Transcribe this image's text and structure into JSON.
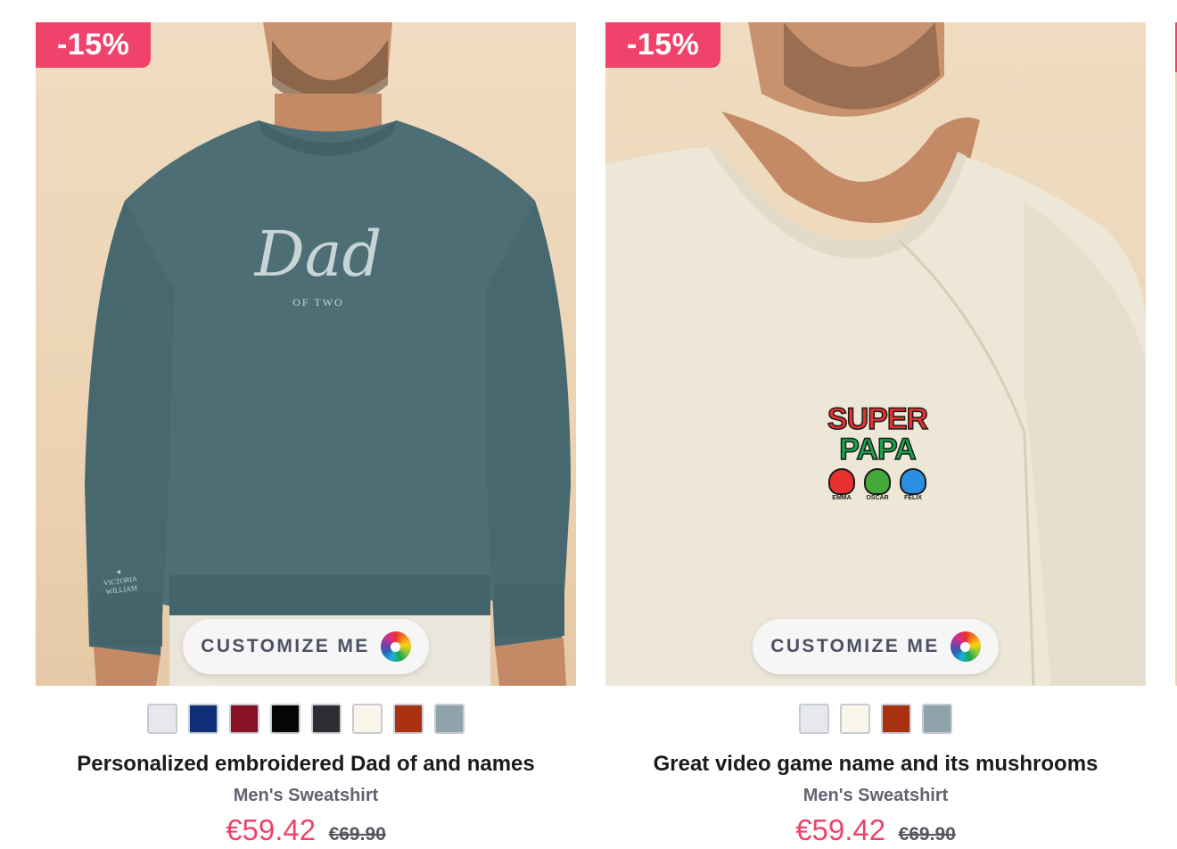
{
  "products": [
    {
      "discount": "-15%",
      "customize_label": "CUSTOMIZE ME",
      "print_text": "Dad",
      "print_subtext": "OF TWO",
      "sleeve_names": [
        "VICTORIA",
        "WILLIAM"
      ],
      "colors": [
        "#e6e8ee",
        "#0f2e77",
        "#8a1026",
        "#050505",
        "#2b2d33",
        "#faf6ec",
        "#a8320f",
        "#8fa3ab"
      ],
      "title": "Personalized embroidered Dad of and names",
      "subtitle": "Men's Sweatshirt",
      "price": "€59.42",
      "old_price": "€69.90"
    },
    {
      "discount": "-15%",
      "customize_label": "CUSTOMIZE ME",
      "print_line1": "SUPER",
      "print_line2": "PAPA",
      "mushroom_names": [
        "EMMA",
        "OSCAR",
        "FELIX"
      ],
      "colors": [
        "#e6e8ee",
        "#faf6ec",
        "#a8320f",
        "#8fa3ab"
      ],
      "title": "Great video game name and its mushrooms",
      "subtitle": "Men's Sweatshirt",
      "price": "€59.42",
      "old_price": "€69.90"
    }
  ],
  "colors": {
    "accent": "#f0436b",
    "sweatshirt1": "#4d6e75",
    "sweatshirt2": "#ede7d8"
  }
}
